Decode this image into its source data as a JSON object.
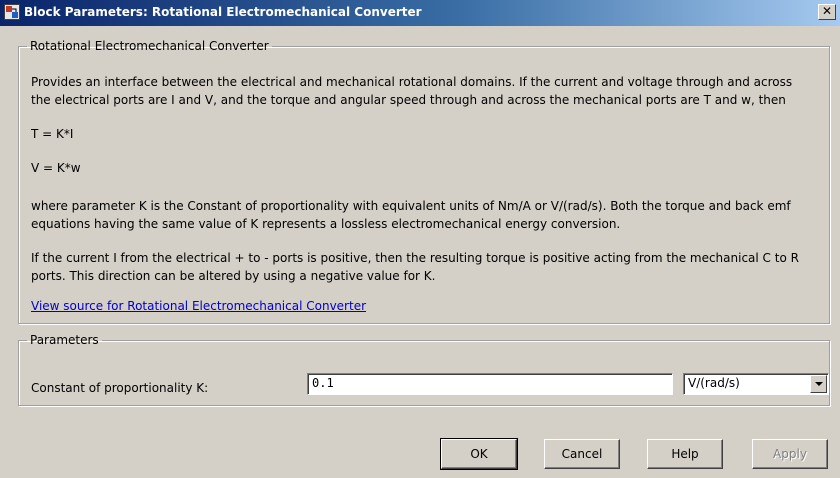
{
  "window": {
    "title": "Block Parameters: Rotational Electromechanical Converter",
    "close_symbol": "✕"
  },
  "description_group": {
    "legend": "Rotational Electromechanical Converter",
    "paragraphs": [
      "Provides an interface between the electrical and mechanical rotational domains. If the current and voltage through and across\nthe electrical ports are I and V, and the torque and angular speed through and across the mechanical ports are T and w, then",
      "T = K*I",
      "V = K*w",
      "where parameter K is the Constant of proportionality with equivalent units of Nm/A or V/(rad/s). Both the torque and back emf\nequations having the same value of K represents a lossless electromechanical energy conversion.",
      "If the current I from the electrical + to - ports is positive, then the resulting torque is positive acting from the mechanical C to R\nports. This direction can be altered by using a negative value for K."
    ],
    "link": "View source for Rotational Electromechanical Converter"
  },
  "parameters_group": {
    "legend": "Parameters",
    "label": "Constant of proportionality K:",
    "value": "0.1",
    "unit": "V/(rad/s)"
  },
  "buttons": {
    "ok": "OK",
    "cancel": "Cancel",
    "help": "Help",
    "apply": "Apply"
  },
  "colors": {
    "titlebar_start": "#0a246a",
    "titlebar_end": "#a6caf0",
    "dialog_bg": "#d4d0c8",
    "link": "#0000cc"
  },
  "icons": [
    "simulink-block-icon",
    "close-icon",
    "chevron-down-icon"
  ]
}
